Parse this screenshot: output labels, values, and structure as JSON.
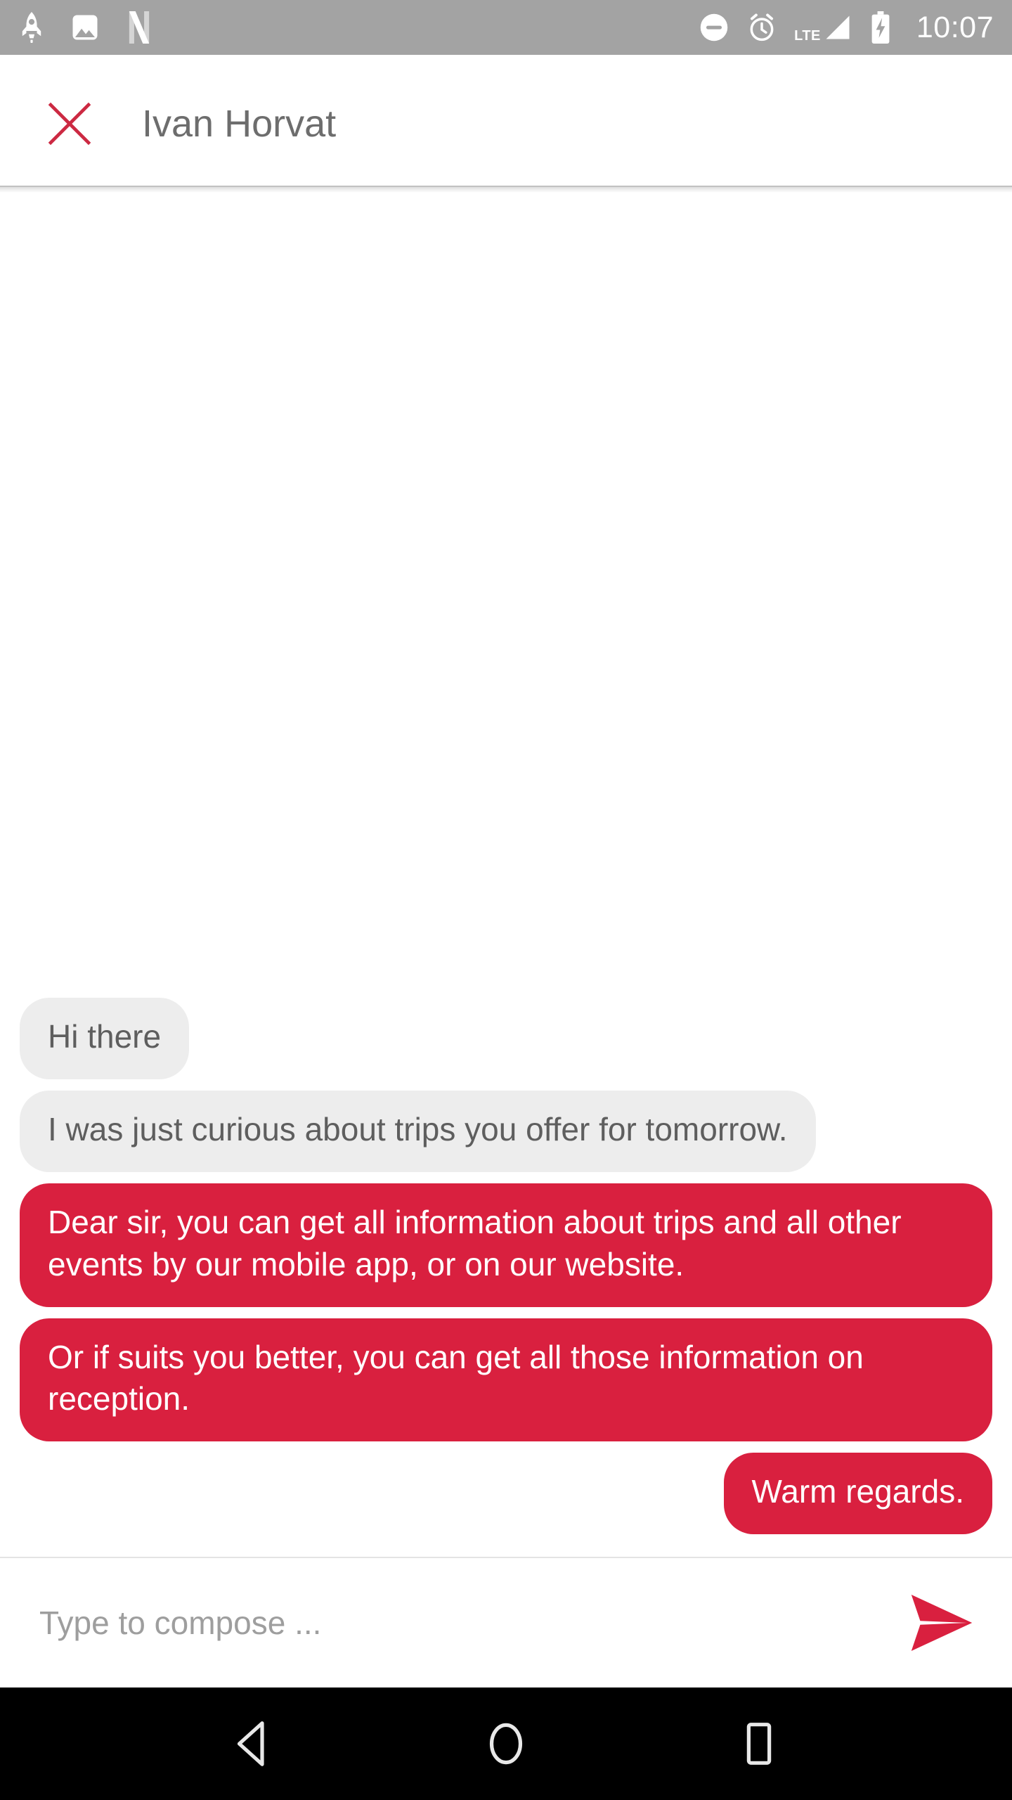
{
  "status_bar": {
    "background": "#a3a3a3",
    "time": "10:07",
    "network_label": "LTE",
    "left_icons": [
      "rocket-icon",
      "photo-icon",
      "netflix-n-icon"
    ],
    "right_icons": [
      "do-not-disturb-icon",
      "alarm-icon",
      "lte-signal-icon",
      "battery-charging-icon"
    ]
  },
  "app_bar": {
    "close_label": "close",
    "title": "Ivan Horvat",
    "title_color": "#6d6d6d",
    "accent_color": "#d9203f"
  },
  "conversation": {
    "incoming_bubble_color": "#ededed",
    "incoming_text_color": "#5e5e5e",
    "outgoing_bubble_color": "#d9203f",
    "outgoing_text_color": "#ffffff",
    "messages": [
      {
        "direction": "in",
        "text": "Hi there"
      },
      {
        "direction": "in",
        "text": "I was just curious about trips you offer for tomorrow."
      },
      {
        "direction": "out",
        "text": "Dear sir, you can get all information about trips and all other events by our mobile app, or on our website."
      },
      {
        "direction": "out",
        "text": "Or if suits you better, you can get all those information on reception."
      },
      {
        "direction": "out",
        "text": "Warm regards."
      }
    ]
  },
  "composer": {
    "placeholder": "Type to compose ...",
    "value": "",
    "send_label": "send",
    "send_color": "#d9203f"
  },
  "nav_bar": {
    "background": "#000000",
    "buttons": [
      "back-button",
      "home-button",
      "recents-button"
    ]
  }
}
